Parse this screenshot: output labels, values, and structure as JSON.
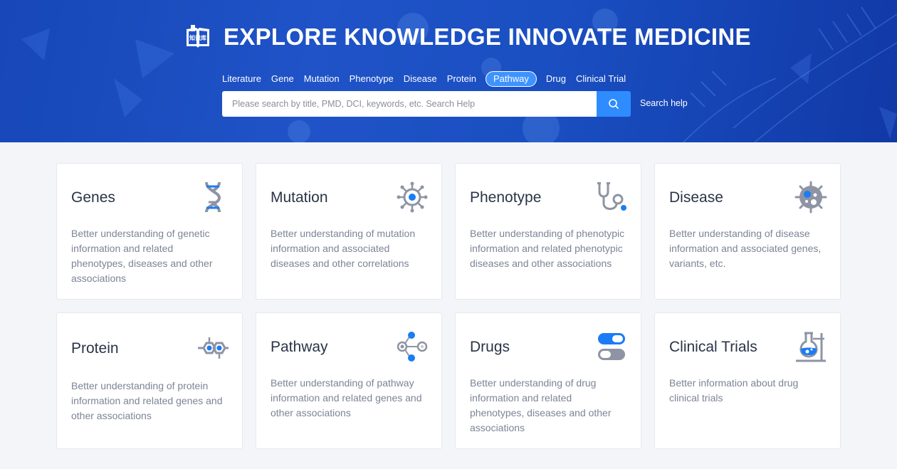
{
  "hero": {
    "title": "EXPLORE KNOWLEDGE  INNOVATE MEDICINE",
    "logo_icon": "book-icon",
    "logo_text": "知识库",
    "tabs": [
      {
        "label": "Literature",
        "active": false
      },
      {
        "label": "Gene",
        "active": false
      },
      {
        "label": "Mutation",
        "active": false
      },
      {
        "label": "Phenotype",
        "active": false
      },
      {
        "label": "Disease",
        "active": false
      },
      {
        "label": "Protein",
        "active": false
      },
      {
        "label": "Pathway",
        "active": true
      },
      {
        "label": "Drug",
        "active": false
      },
      {
        "label": "Clinical Trial",
        "active": false
      }
    ],
    "search": {
      "placeholder": "Please search by title, PMD, DCI, keywords, etc. Search Help",
      "value": "",
      "button_icon": "search-icon"
    },
    "search_help": "Search help"
  },
  "cards": [
    {
      "title": "Genes",
      "icon": "dna-icon",
      "desc": "Better understanding of genetic information and related phenotypes, diseases and other associations"
    },
    {
      "title": "Mutation",
      "icon": "virus-icon",
      "desc": "Better understanding of mutation information and associated diseases and other correlations"
    },
    {
      "title": "Phenotype",
      "icon": "stethoscope-icon",
      "desc": "Better understanding of phenotypic information and related phenotypic diseases and other associations"
    },
    {
      "title": "Disease",
      "icon": "bacteria-icon",
      "desc": "Better understanding of disease information and associated genes, variants, etc."
    },
    {
      "title": "Protein",
      "icon": "molecule-icon",
      "desc": "Better understanding of protein information and related genes and other associations"
    },
    {
      "title": "Pathway",
      "icon": "pathway-icon",
      "desc": "Better understanding of pathway  information and related genes and other associations"
    },
    {
      "title": "Drugs",
      "icon": "capsule-icon",
      "desc": "Better understanding of drug information and related phenotypes, diseases and other associations"
    },
    {
      "title": "Clinical Trials",
      "icon": "flask-icon",
      "desc": "Better information about drug clinical trials"
    }
  ],
  "colors": {
    "hero_bg": "#1f53c7",
    "accent": "#2e8cff",
    "icon_gray": "#8e94a3",
    "icon_blue": "#1b7cf5",
    "card_title": "#2a3447",
    "card_text": "#7c8496"
  }
}
